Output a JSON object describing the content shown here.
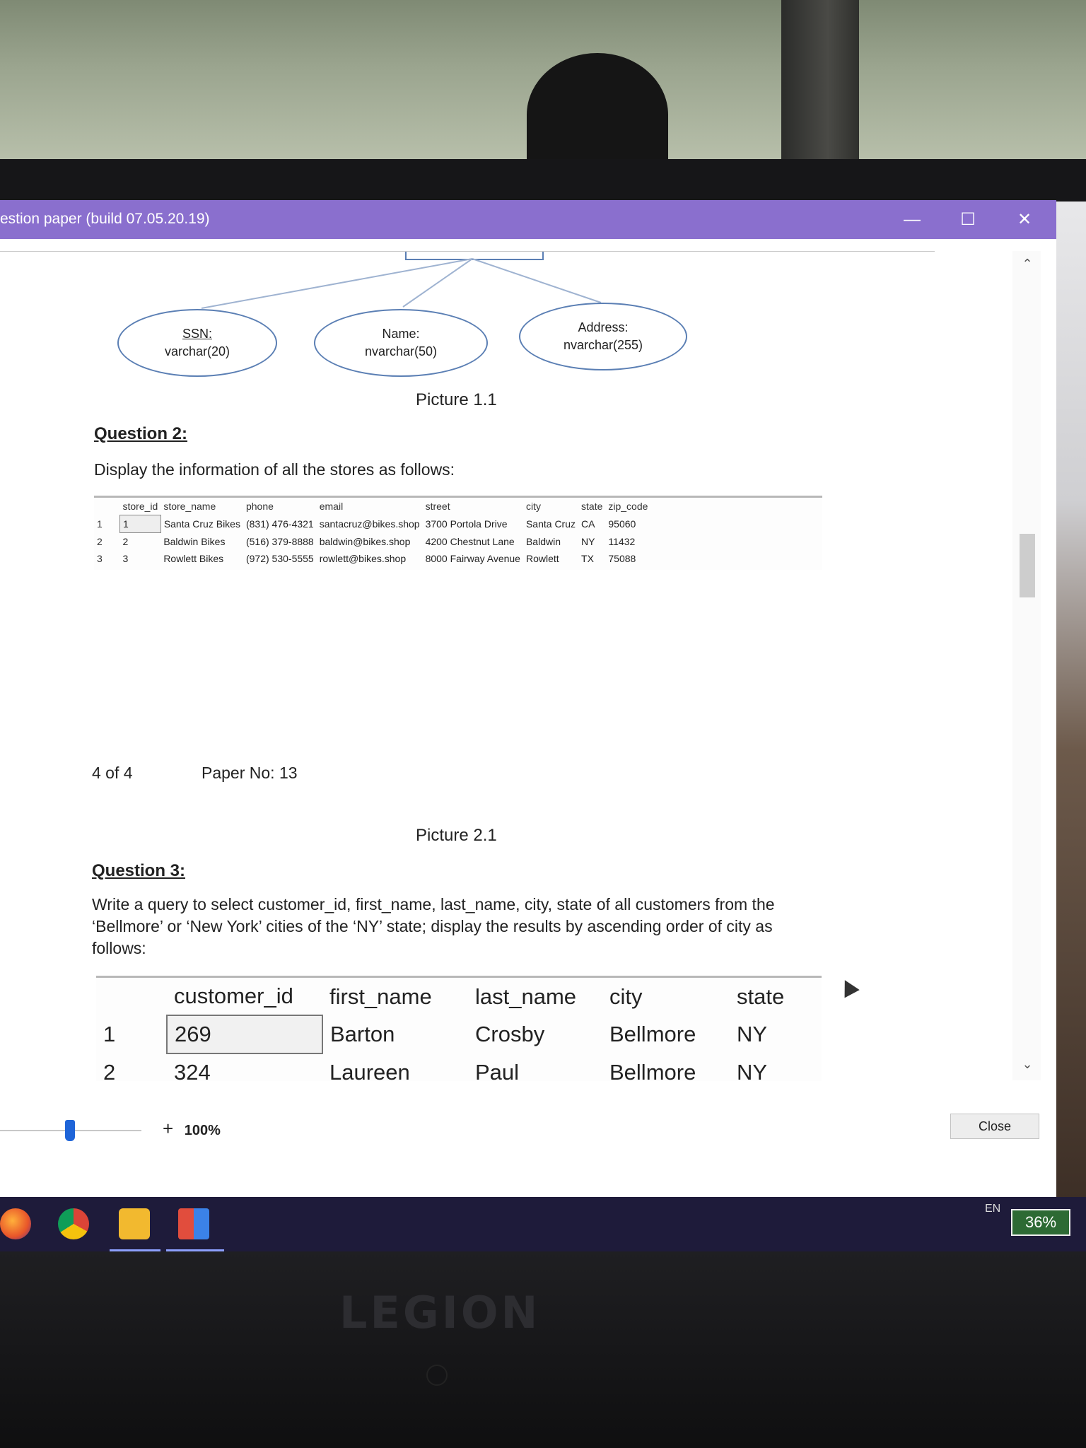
{
  "window": {
    "title": "estion paper (build 07.05.20.19)",
    "minimize_icon": "—",
    "maximize_icon": "☐",
    "close_icon": "✕"
  },
  "diagram": {
    "attributes": [
      {
        "name": "SSN:",
        "type": "varchar(20)"
      },
      {
        "name": "Name:",
        "type": "nvarchar(50)"
      },
      {
        "name": "Address:",
        "type": "nvarchar(255)"
      }
    ],
    "caption": "Picture 1.1"
  },
  "question2": {
    "heading": "Question 2:",
    "text": "Display the information of all the stores as follows:",
    "columns": [
      "store_id",
      "store_name",
      "phone",
      "email",
      "street",
      "city",
      "state",
      "zip_code"
    ],
    "rows": [
      {
        "n": "1",
        "cells": [
          "1",
          "Santa Cruz Bikes",
          "(831) 476-4321",
          "santacruz@bikes.shop",
          "3700 Portola Drive",
          "Santa Cruz",
          "CA",
          "95060"
        ]
      },
      {
        "n": "2",
        "cells": [
          "2",
          "Baldwin Bikes",
          "(516) 379-8888",
          "baldwin@bikes.shop",
          "4200 Chestnut Lane",
          "Baldwin",
          "NY",
          "11432"
        ]
      },
      {
        "n": "3",
        "cells": [
          "3",
          "Rowlett Bikes",
          "(972) 530-5555",
          "rowlett@bikes.shop",
          "8000 Fairway Avenue",
          "Rowlett",
          "TX",
          "75088"
        ]
      }
    ]
  },
  "footer": {
    "page": "4 of 4",
    "paper": "Paper No: 13"
  },
  "picture2_caption": "Picture 2.1",
  "question3": {
    "heading": "Question 3:",
    "text": "Write a query to select customer_id, first_name, last_name, city, state of all customers from the ‘Bellmore’ or ‘New York’ cities of the ‘NY’ state; display the results by ascending order of city as follows:",
    "columns": [
      "customer_id",
      "first_name",
      "last_name",
      "city",
      "state"
    ],
    "rows": [
      {
        "n": "1",
        "cells": [
          "269",
          "Barton",
          "Crosby",
          "Bellmore",
          "NY"
        ]
      },
      {
        "n": "2",
        "cells": [
          "324",
          "Laureen",
          "Paul",
          "Bellmore",
          "NY"
        ]
      }
    ]
  },
  "controls": {
    "zoom_plus": "+",
    "zoom_level": "100%",
    "close_label": "Close"
  },
  "taskbar": {
    "language": "EN",
    "battery": "36%"
  },
  "bezel_brand": "LEGION",
  "colors": {
    "titlebar": "#8a6fce",
    "taskbar": "#1e1b3a",
    "slider_thumb": "#1e64d8",
    "ellipse_border": "#5b7fb4"
  }
}
